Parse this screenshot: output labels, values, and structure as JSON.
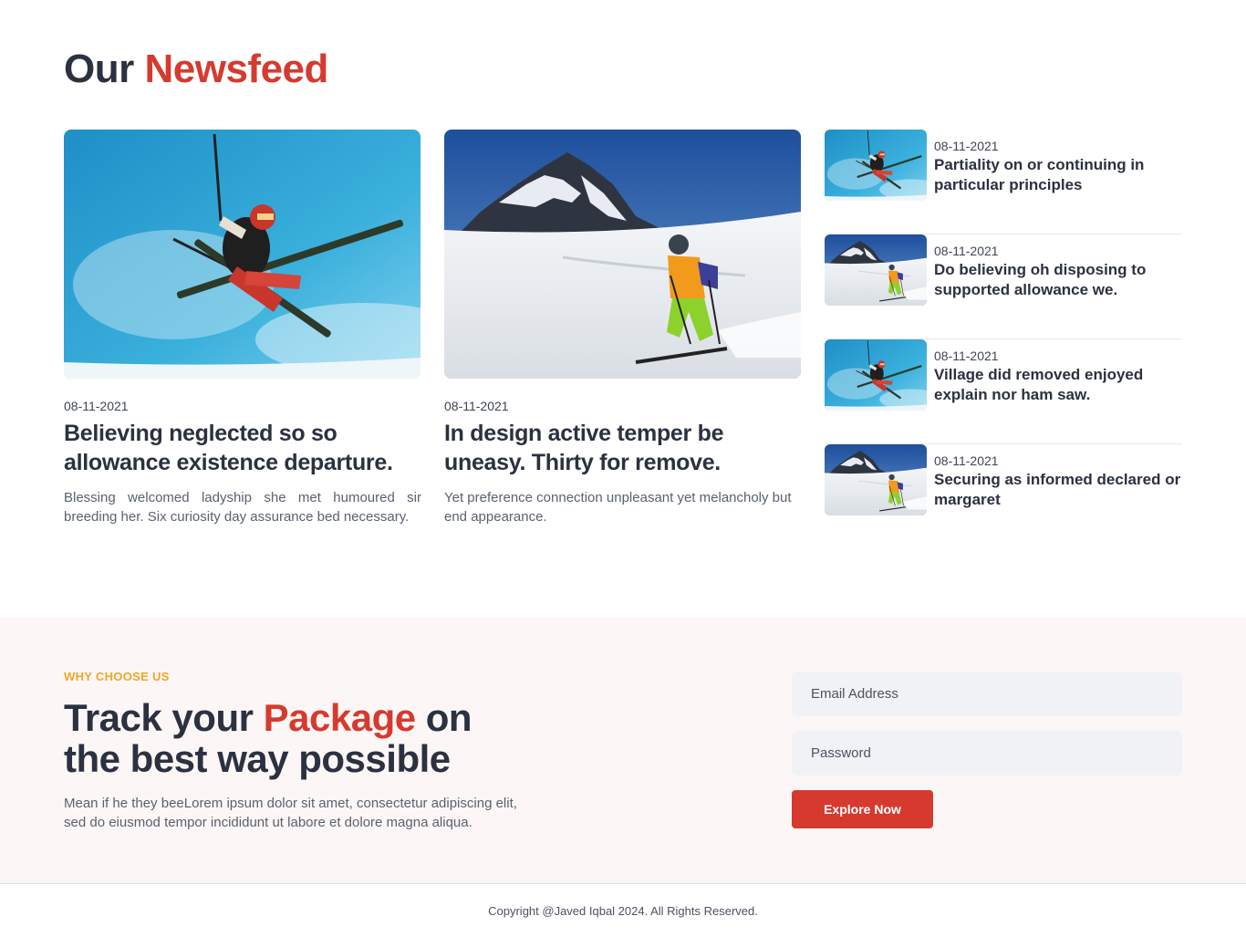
{
  "newsfeed": {
    "title_plain": "Our",
    "title_accent": "Newsfeed",
    "cards": [
      {
        "image": "ski-jump-image",
        "date": "08-11-2021",
        "title": "Believing neglected so so allowance existence departure.",
        "text": "Blessing welcomed ladyship she met humoured sir breeding her. Six curiosity day assurance bed necessary."
      },
      {
        "image": "mountain-skier-image",
        "date": "08-11-2021",
        "title": "In design active temper be uneasy. Thirty for remove.",
        "text": "Yet preference connection unpleasant yet melancholy but end appearance."
      }
    ],
    "side_items": [
      {
        "image": "ski-jump-image",
        "date": "08-11-2021",
        "title": "Partiality on or continuing in particular principles"
      },
      {
        "image": "mountain-skier-image",
        "date": "08-11-2021",
        "title": "Do believing oh disposing to supported allowance we."
      },
      {
        "image": "ski-jump-image",
        "date": "08-11-2021",
        "title": "Village did removed enjoyed explain nor ham saw."
      },
      {
        "image": "mountain-skier-image",
        "date": "08-11-2021",
        "title": "Securing as informed declared or margaret"
      }
    ]
  },
  "track": {
    "eyebrow": "WHY CHOOSE US",
    "title_part1": "Track your",
    "title_accent": "Package",
    "title_part2": "on the best way possible",
    "text": "Mean if he they beeLorem ipsum dolor sit amet, consectetur adipiscing elit, sed do eiusmod tempor incididunt ut labore et dolore magna aliqua.",
    "email_placeholder": "Email Address",
    "password_placeholder": "Password",
    "button_label": "Explore Now"
  },
  "footer": {
    "copyright": "Copyright @Javed Iqbal 2024. All Rights Reserved."
  },
  "colors": {
    "accent": "#d63a2f",
    "eyebrow": "#f0a52b",
    "heading": "#2b3140",
    "section_bg": "#fcf7f6"
  }
}
